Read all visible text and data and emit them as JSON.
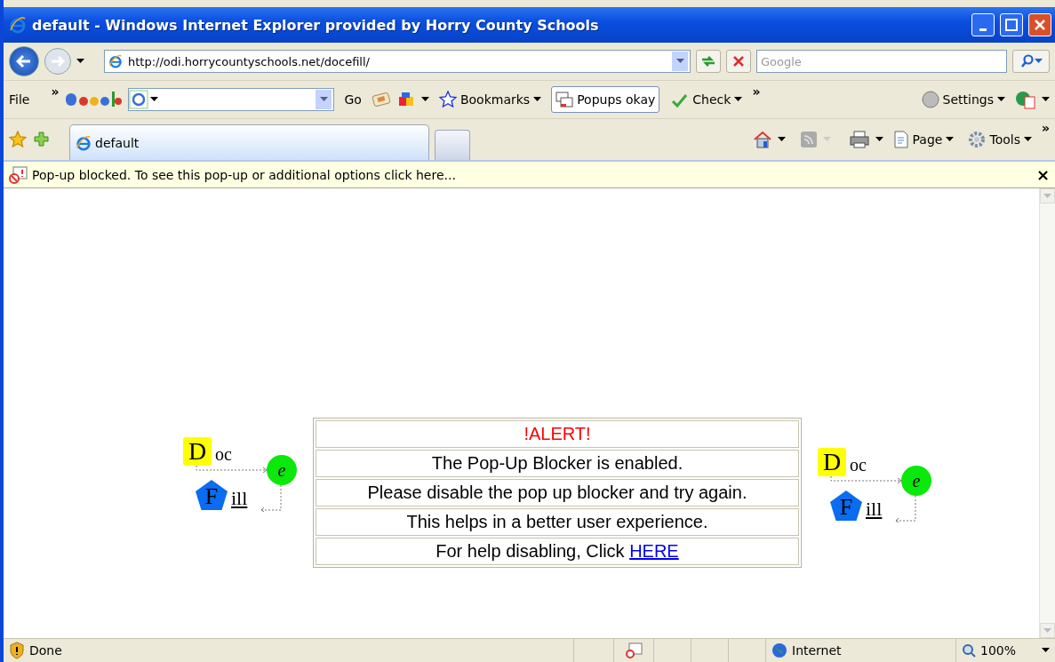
{
  "window": {
    "title": "default - Windows Internet Explorer provided by Horry County Schools"
  },
  "address_bar": {
    "url": "http://odi.horrycountyschools.net/docefill/",
    "search_placeholder": "Google"
  },
  "menu_toolbar": {
    "file": "File",
    "chevron": "»",
    "go": "Go",
    "items": [
      {
        "label": "Bookmarks",
        "kind": "menu"
      },
      {
        "label": "Popups okay",
        "kind": "toggle"
      },
      {
        "label": "Check",
        "kind": "menu"
      }
    ],
    "more": "»",
    "settings": "Settings"
  },
  "tab_bar": {
    "tabs": [
      {
        "label": "default",
        "selected": true
      }
    ],
    "commands": [
      "Page",
      "Tools"
    ],
    "more": "»"
  },
  "info_bar": {
    "text": "Pop-up blocked. To see this pop-up or additional options click here...",
    "close": "×"
  },
  "logos": [
    {
      "d": "D",
      "oc": "oc",
      "e": "e",
      "f": "F",
      "ill": "ill"
    },
    {
      "d": "D",
      "oc": "oc",
      "e": "e",
      "f": "F",
      "ill": "ill"
    }
  ],
  "alert_table": {
    "rows": [
      {
        "kind": "alert",
        "text": "!ALERT!"
      },
      {
        "kind": "plain",
        "text": "The Pop-Up Blocker is enabled."
      },
      {
        "kind": "plain",
        "text": "Please disable the pop up blocker and try again."
      },
      {
        "kind": "plain",
        "text": "This helps in a better user experience."
      },
      {
        "kind": "link",
        "text": "For help disabling, Click ",
        "link": "HERE"
      }
    ]
  },
  "status_bar": {
    "text": "Done",
    "zone": "Internet",
    "zoom": "100%"
  }
}
